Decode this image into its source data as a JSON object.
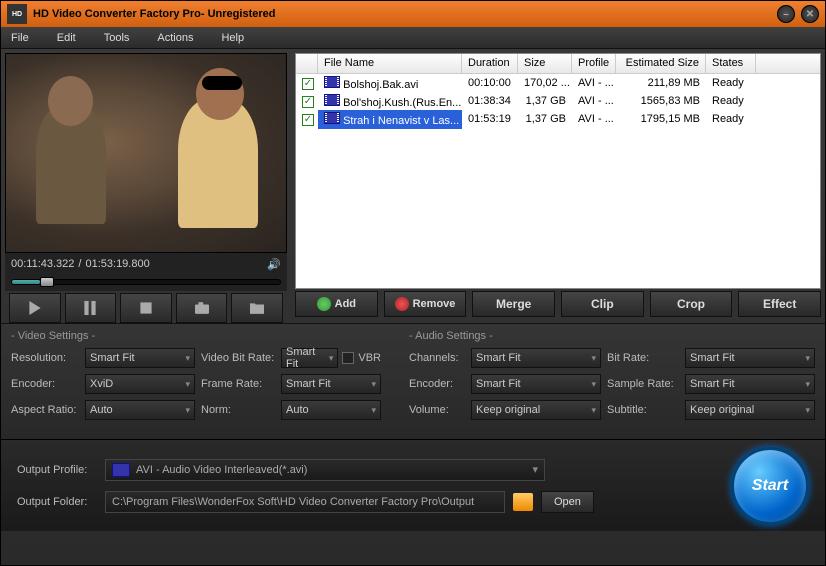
{
  "title": "HD Video Converter Factory Pro- Unregistered",
  "menu": [
    "File",
    "Edit",
    "Tools",
    "Actions",
    "Help"
  ],
  "player": {
    "position": "00:11:43.322",
    "duration": "01:53:19.800",
    "progress_pct": 10.3
  },
  "file_header": {
    "name": "File Name",
    "duration": "Duration",
    "size": "Size",
    "profile": "Profile",
    "est": "Estimated Size",
    "state": "States"
  },
  "files": [
    {
      "checked": true,
      "name": "Bolshoj.Bak.avi",
      "duration": "00:10:00",
      "size": "170,02 ...",
      "profile": "AVI - ...",
      "est": "211,89 MB",
      "state": "Ready",
      "selected": false
    },
    {
      "checked": true,
      "name": "Bol'shoj.Kush.(Rus.En...",
      "duration": "01:38:34",
      "size": "1,37 GB",
      "profile": "AVI - ...",
      "est": "1565,83 MB",
      "state": "Ready",
      "selected": false
    },
    {
      "checked": true,
      "name": "Strah i Nenavist v Las...",
      "duration": "01:53:19",
      "size": "1,37 GB",
      "profile": "AVI - ...",
      "est": "1795,15 MB",
      "state": "Ready",
      "selected": true
    }
  ],
  "actions": {
    "add": "Add",
    "remove": "Remove",
    "merge": "Merge",
    "clip": "Clip",
    "crop": "Crop",
    "effect": "Effect"
  },
  "video_settings": {
    "title": "- Video Settings -",
    "labels": {
      "resolution": "Resolution:",
      "encoder": "Encoder:",
      "aspect": "Aspect Ratio:",
      "bitrate": "Video Bit Rate:",
      "framerate": "Frame Rate:",
      "norm": "Norm:",
      "vbr": "VBR"
    },
    "values": {
      "resolution": "Smart Fit",
      "encoder": "XviD",
      "aspect": "Auto",
      "bitrate": "Smart Fit",
      "framerate": "Smart Fit",
      "norm": "Auto"
    }
  },
  "audio_settings": {
    "title": "- Audio Settings -",
    "labels": {
      "channels": "Channels:",
      "encoder": "Encoder:",
      "volume": "Volume:",
      "bitrate": "Bit Rate:",
      "samplerate": "Sample Rate:",
      "subtitle": "Subtitle:"
    },
    "values": {
      "channels": "Smart Fit",
      "encoder": "Smart Fit",
      "volume": "Keep original",
      "bitrate": "Smart Fit",
      "samplerate": "Smart Fit",
      "subtitle": "Keep original"
    }
  },
  "output": {
    "profile_label": "Output Profile:",
    "profile_value": "AVI - Audio Video Interleaved(*.avi)",
    "folder_label": "Output Folder:",
    "folder_value": "C:\\Program Files\\WonderFox Soft\\HD Video Converter Factory Pro\\Output",
    "open": "Open",
    "start": "Start"
  }
}
